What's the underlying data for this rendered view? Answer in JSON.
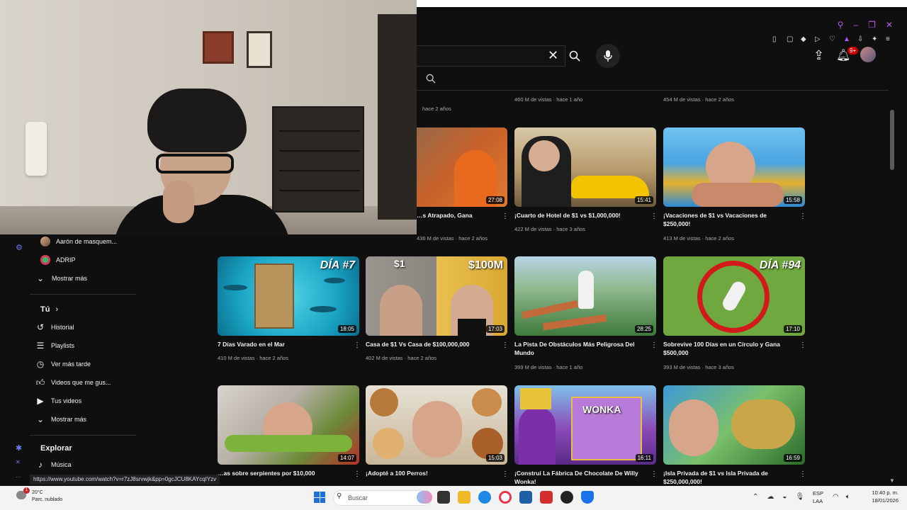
{
  "header": {
    "notif_count": "9+",
    "clear_icon": "close-icon",
    "search_icon": "search-icon",
    "mic_icon": "mic-icon"
  },
  "sidebar": {
    "subs": [
      {
        "label": "Aarón de masquem..."
      },
      {
        "label": "ADRIP"
      }
    ],
    "show_more_1": "Mostrar más",
    "you_heading": "Tú",
    "you_items": [
      {
        "label": "Historial",
        "icon": "history-icon"
      },
      {
        "label": "Playlists",
        "icon": "playlist-icon"
      },
      {
        "label": "Ver más tarde",
        "icon": "clock-icon"
      },
      {
        "label": "Videos que me gus...",
        "icon": "thumbs-up-icon"
      },
      {
        "label": "Tus videos",
        "icon": "video-icon"
      }
    ],
    "show_more_2": "Mostrar más",
    "explore_heading": "Explorar",
    "explore_items": [
      {
        "label": "Música",
        "icon": "music-icon"
      }
    ]
  },
  "prev_row": {
    "meta_a": "hace 2 años",
    "meta_b": "460 M de vistas · hace 1 año",
    "meta_c": "454 M de vistas · hace 2 años"
  },
  "videos_row1": [
    {
      "title": "…s Atrapado, Gana",
      "meta": "436 M de vistas · hace 2 años",
      "duration": "27:08"
    },
    {
      "title": "¡Cuarto de Hotel de $1 vs $1,000,000!",
      "meta": "422 M de vistas · hace 3 años",
      "duration": "15:41"
    },
    {
      "title": "¡Vacaciones de $1 vs Vacaciones de $250,000!",
      "meta": "413 M de vistas · hace 2 años",
      "duration": "15:58"
    }
  ],
  "videos_row2": [
    {
      "title": "7 Días Varado en el Mar",
      "meta": "410 M de vistas · hace 2 años",
      "duration": "18:05",
      "overlay": "DÍA #7"
    },
    {
      "title": "Casa de $1 Vs Casa de $100,000,000",
      "meta": "402 M de vistas · hace 2 años",
      "duration": "17:03",
      "overlay": "$100M",
      "overlay_left": "$1"
    },
    {
      "title": "La Pista De Obstáculos Más Peligrosa Del Mundo",
      "meta": "399 M de vistas · hace 1 año",
      "duration": "28:25"
    },
    {
      "title": "Sobrevive 100 Días en un Círculo y Gana $500,000",
      "meta": "393 M de vistas · hace 3 años",
      "duration": "17:10",
      "overlay": "DÍA #94"
    }
  ],
  "videos_row3": [
    {
      "title": "…as sobre serpientes por $10,000",
      "duration": "14:07"
    },
    {
      "title": "¡Adopté a 100 Perros!",
      "duration": "15:03"
    },
    {
      "title": "¡Construí La Fábrica De Chocolate De Willy Wonka!",
      "duration": "16:11",
      "overlay_mid": "WONKA"
    },
    {
      "title": "¡Isla Privada de $1 vs Isla Privada de $250,000,000!",
      "duration": "16:59"
    }
  ],
  "status_url": "https://www.youtube.com/watch?v=r7zJ8srvwjk&pp=0gcJCU8KAYcqIYzv",
  "taskbar": {
    "temp": "20°C",
    "weather": "Parc. nublado",
    "search_label": "Buscar",
    "lang": "ESP",
    "region": "LAA",
    "time": "10:40 p. m.",
    "date": "18/01/2026",
    "weather_badge": "1"
  }
}
